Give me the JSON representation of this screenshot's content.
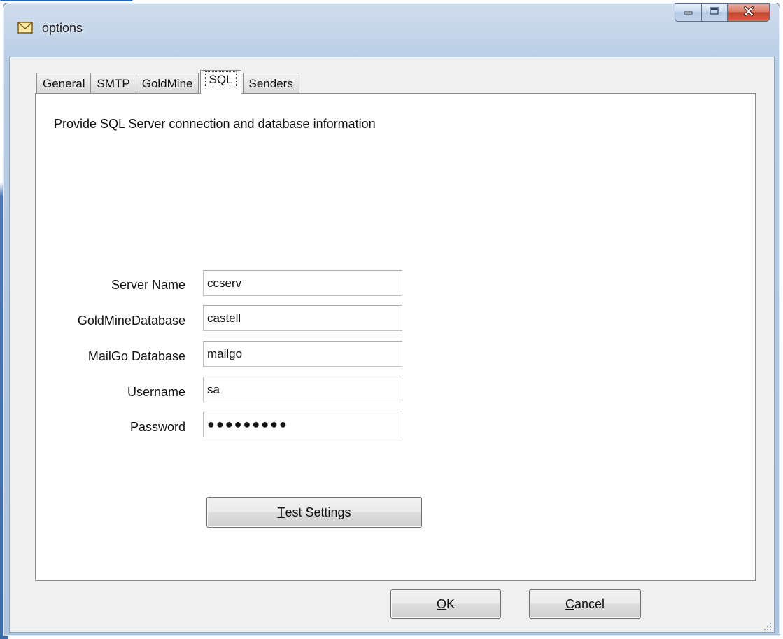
{
  "window": {
    "title": "options",
    "icon": "envelope-icon",
    "caption_buttons": [
      "minimize-icon",
      "maximize-icon",
      "close-icon"
    ]
  },
  "tabs": [
    {
      "label": "General",
      "active": false
    },
    {
      "label": "SMTP",
      "active": false
    },
    {
      "label": "GoldMine",
      "active": false
    },
    {
      "label": "SQL",
      "active": true
    },
    {
      "label": "Senders",
      "active": false
    }
  ],
  "sql_panel": {
    "description": "Provide SQL Server connection and database information",
    "fields": {
      "server_name": {
        "label": "Server Name",
        "value": "ccserv"
      },
      "goldmine_database": {
        "label": "GoldMineDatabase",
        "value": "castell"
      },
      "mailgo_database": {
        "label": "MailGo Database",
        "value": "mailgo"
      },
      "username": {
        "label": "Username",
        "value": "sa"
      },
      "password": {
        "label": "Password",
        "value": "●●●●●●●●●"
      }
    },
    "test_button": {
      "mnemonic": "T",
      "rest": "est Settings"
    }
  },
  "footer": {
    "ok_button": {
      "mnemonic": "O",
      "rest": "K"
    },
    "cancel_button": {
      "mnemonic": "C",
      "rest": "ancel"
    }
  }
}
